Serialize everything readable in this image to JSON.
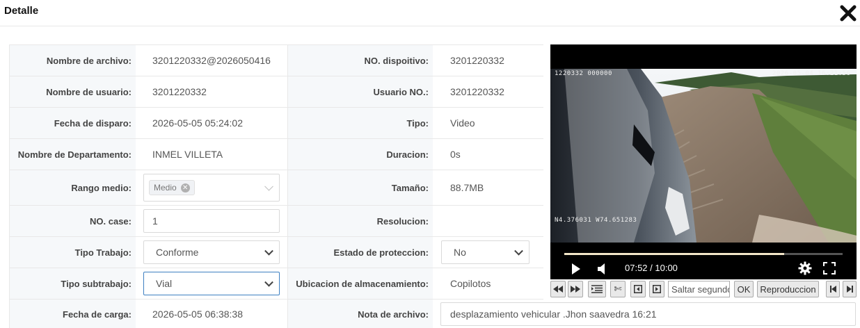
{
  "dialog": {
    "title": "Detalle"
  },
  "fields": {
    "file_name": {
      "label": "Nombre de archivo:",
      "value": "3201220332@2026050416"
    },
    "device_no": {
      "label": "NO. dispoitivo:",
      "value": "3201220332"
    },
    "user_name": {
      "label": "Nombre de usuario:",
      "value": "3201220332"
    },
    "user_no": {
      "label": "Usuario NO.:",
      "value": "3201220332"
    },
    "trigger_date": {
      "label": "Fecha de disparo:",
      "value": "2026-05-05 05:24:02"
    },
    "type": {
      "label": "Tipo:",
      "value": "Video"
    },
    "department": {
      "label": "Nombre de Departamento:",
      "value": "INMEL VILLETA"
    },
    "duration": {
      "label": "Duracion:",
      "value": "0s"
    },
    "media_range": {
      "label": "Rango medio:",
      "tag": "Medio"
    },
    "size": {
      "label": "Tamaño:",
      "value": "88.7MB"
    },
    "case_no": {
      "label": "NO. case:",
      "value": "1"
    },
    "resolution": {
      "label": "Resolucion:",
      "value": ""
    },
    "work_type": {
      "label": "Tipo Trabajo:",
      "value": "Conforme"
    },
    "protection": {
      "label": "Estado de proteccion:",
      "value": "No"
    },
    "sub_work_type": {
      "label": "Tipo subtrabajo:",
      "value": "Vial"
    },
    "storage": {
      "label": "Ubicacion de almacenamiento:",
      "value": "Copilotos"
    },
    "upload_date": {
      "label": "Fecha de carga:",
      "value": "2026-05-05 06:38:38"
    },
    "file_note": {
      "label": "Nota de archivo:",
      "value": "desplazamiento vehicular .Jhon saavedra 16:21"
    }
  },
  "video": {
    "osd_id": "1220332 000000",
    "osd_datetime": "2026-05-04 16:21:56",
    "osd_gps": "N4.376031 W74.651283",
    "time": "07:52 / 10:00",
    "progress": 0.79
  },
  "toolbar": {
    "skip_placeholder": "Saltar segundos",
    "ok_label": "OK",
    "playback_label": "Reproduccion"
  }
}
